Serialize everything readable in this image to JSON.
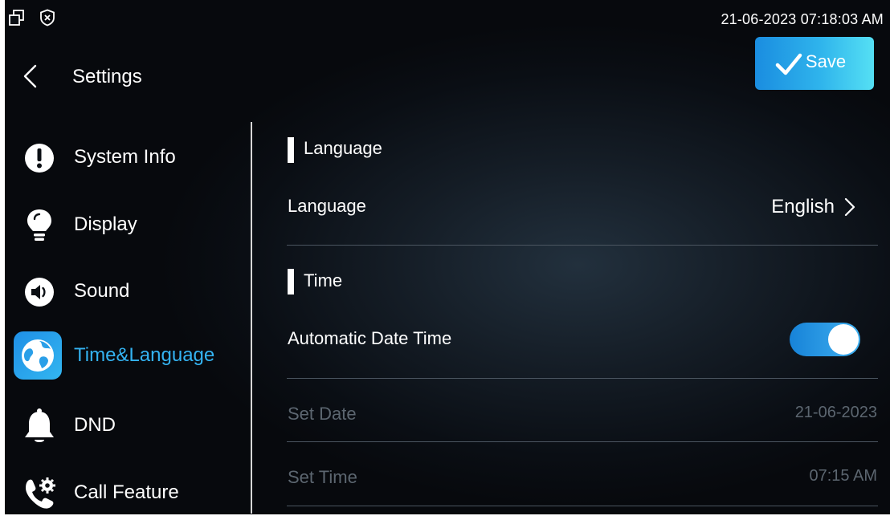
{
  "status_bar": {
    "left_icons": [
      "window-restore-icon",
      "shield-x-icon"
    ],
    "datetime": "21-06-2023 07:18:03 AM"
  },
  "header": {
    "back_icon": "chevron-left-icon",
    "title": "Settings",
    "save_label": "Save",
    "save_icon": "checkmark-icon"
  },
  "sidebar": {
    "items": [
      {
        "label": "System Info",
        "icon": "exclamation-circle-icon",
        "active": false
      },
      {
        "label": "Display",
        "icon": "lightbulb-icon",
        "active": false
      },
      {
        "label": "Sound",
        "icon": "speaker-icon",
        "active": false
      },
      {
        "label": "Time&Language",
        "icon": "globe-icon",
        "active": true
      },
      {
        "label": "DND",
        "icon": "bell-icon",
        "active": false
      },
      {
        "label": "Call Feature",
        "icon": "phone-gear-icon",
        "active": false
      }
    ]
  },
  "content": {
    "language_section": {
      "title": "Language",
      "row_label": "Language",
      "row_value": "English"
    },
    "time_section": {
      "title": "Time",
      "auto_label": "Automatic Date Time",
      "auto_enabled": true,
      "set_date_label": "Set Date",
      "set_date_value": "21-06-2023",
      "set_time_label": "Set Time",
      "set_time_value": "07:15 AM"
    }
  },
  "colors": {
    "accent": "#34b3f2",
    "save_gradient_start": "#1a8de0",
    "save_gradient_end": "#55e0f4",
    "disabled_text": "#5c6670"
  }
}
